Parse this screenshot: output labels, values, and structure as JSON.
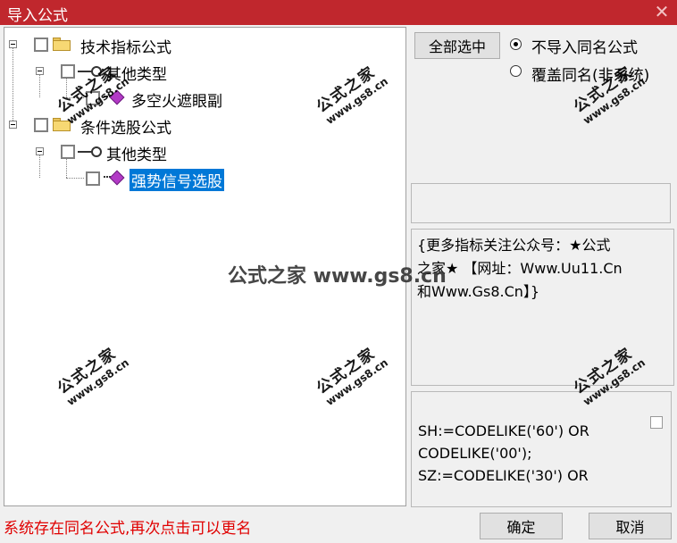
{
  "window": {
    "title": "导入公式",
    "close_glyph": "✕"
  },
  "tree": {
    "n1": {
      "label": "技术指标公式"
    },
    "n1_1": {
      "label": "其他类型"
    },
    "n1_1_1": {
      "label": "多空火遮眼副"
    },
    "n2": {
      "label": "条件选股公式"
    },
    "n2_1": {
      "label": "其他类型"
    },
    "n2_1_1": {
      "label": "强势信号选股"
    }
  },
  "buttons": {
    "select_all": "全部选中",
    "ok": "确定",
    "cancel": "取消"
  },
  "options": {
    "no_import_same": "不导入同名公式",
    "overwrite_same": "覆盖同名(非系统)",
    "selected": "no_import_same"
  },
  "description": {
    "line1": "{更多指标关注公众号：★公式",
    "line2": "之家★ 【网址：Www.Uu11.Cn",
    "line3": "和Www.Gs8.Cn】}"
  },
  "code": {
    "line1": "SH:=CODELIKE('60') OR",
    "line2": "CODELIKE('00');",
    "line3": "SZ:=CODELIKE('30') OR"
  },
  "status": {
    "message": "系统存在同名公式,再次点击可以更名"
  },
  "watermark": {
    "text_big": "公式之家",
    "text_small": "www.gs8.cn",
    "center": "公式之家 www.gs8.cn"
  },
  "colors": {
    "title_bar": "#c0272d",
    "selection": "#0078d7",
    "status_text": "#e00000"
  }
}
